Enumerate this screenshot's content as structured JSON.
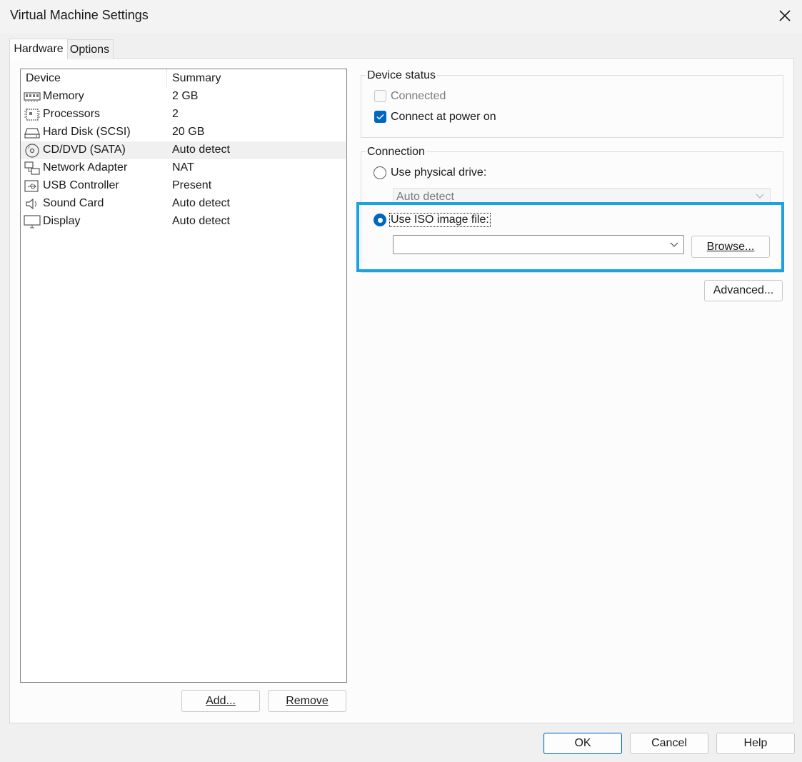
{
  "window": {
    "title": "Virtual Machine Settings"
  },
  "tabs": [
    {
      "label": "Hardware"
    },
    {
      "label": "Options"
    }
  ],
  "device_list": {
    "columns": [
      "Device",
      "Summary"
    ],
    "rows": [
      {
        "device": "Memory",
        "summary": "2 GB",
        "icon": "memory-icon"
      },
      {
        "device": "Processors",
        "summary": "2",
        "icon": "processor-icon"
      },
      {
        "device": "Hard Disk (SCSI)",
        "summary": "20 GB",
        "icon": "hard-disk-icon"
      },
      {
        "device": "CD/DVD (SATA)",
        "summary": "Auto detect",
        "icon": "cd-dvd-icon"
      },
      {
        "device": "Network Adapter",
        "summary": "NAT",
        "icon": "network-adapter-icon"
      },
      {
        "device": "USB Controller",
        "summary": "Present",
        "icon": "usb-icon"
      },
      {
        "device": "Sound Card",
        "summary": "Auto detect",
        "icon": "speaker-icon"
      },
      {
        "device": "Display",
        "summary": "Auto detect",
        "icon": "monitor-icon"
      }
    ],
    "add_label": "Add...",
    "remove_label": "Remove"
  },
  "device_status": {
    "label": "Device status",
    "connected_label": "Connected",
    "connected_checked": false,
    "connected_enabled": false,
    "power_on_label": "Connect at power on",
    "power_on_checked": true
  },
  "connection": {
    "label": "Connection",
    "physical_label": "Use physical drive:",
    "physical_selected": false,
    "physical_value": "Auto detect",
    "iso_label": "Use ISO image file:",
    "iso_selected": true,
    "iso_value": "",
    "browse_label": "Browse...",
    "advanced_label": "Advanced..."
  },
  "footer": {
    "ok_label": "OK",
    "cancel_label": "Cancel",
    "help_label": "Help"
  },
  "colors": {
    "accent": "#0067c0",
    "highlight": "#1aa3e0"
  }
}
